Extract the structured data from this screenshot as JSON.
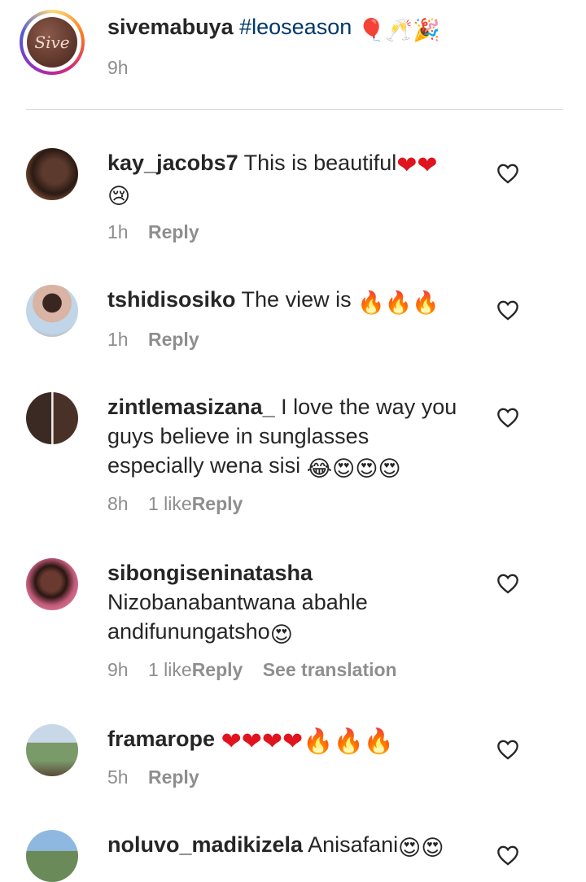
{
  "caption": {
    "avatar_text": "Sive",
    "username": "sivemabuya",
    "hashtag": "#leoseason",
    "emojis": "🎈🥂🎉",
    "time": "9h"
  },
  "comments": [
    {
      "username": "kay_jacobs7",
      "text": "This is beautiful",
      "emojis": "❤❤",
      "emoji_line2": "😢",
      "time": "1h",
      "likes": "",
      "reply": "Reply",
      "translation": ""
    },
    {
      "username": "tshidisosiko",
      "text": "The view is",
      "emojis": "🔥🔥🔥",
      "time": "1h",
      "likes": "",
      "reply": "Reply",
      "translation": ""
    },
    {
      "username": "zintlemasizana_",
      "text": "I love the way you guys believe in sunglasses especially wena sisi",
      "emojis": "😂😍😍😍",
      "time": "8h",
      "likes": "1 like",
      "reply": "Reply",
      "translation": ""
    },
    {
      "username": "sibongiseninatasha",
      "text": "Nizobanabantwana abahle andifunungatsho",
      "emojis": "😍",
      "time": "9h",
      "likes": "1 like",
      "reply": "Reply",
      "translation": "See translation"
    },
    {
      "username": "framarope",
      "text": "",
      "emojis": "❤❤❤❤🔥🔥🔥",
      "time": "5h",
      "likes": "",
      "reply": "Reply",
      "translation": ""
    },
    {
      "username": "noluvo_madikizela",
      "text": "Anisafani",
      "emojis": "😍😍",
      "time": "",
      "likes": "",
      "reply": "",
      "translation": ""
    }
  ],
  "colors": {
    "accent_link": "#00376b",
    "muted": "#8e8e8e",
    "heart_red": "#e0141e"
  }
}
